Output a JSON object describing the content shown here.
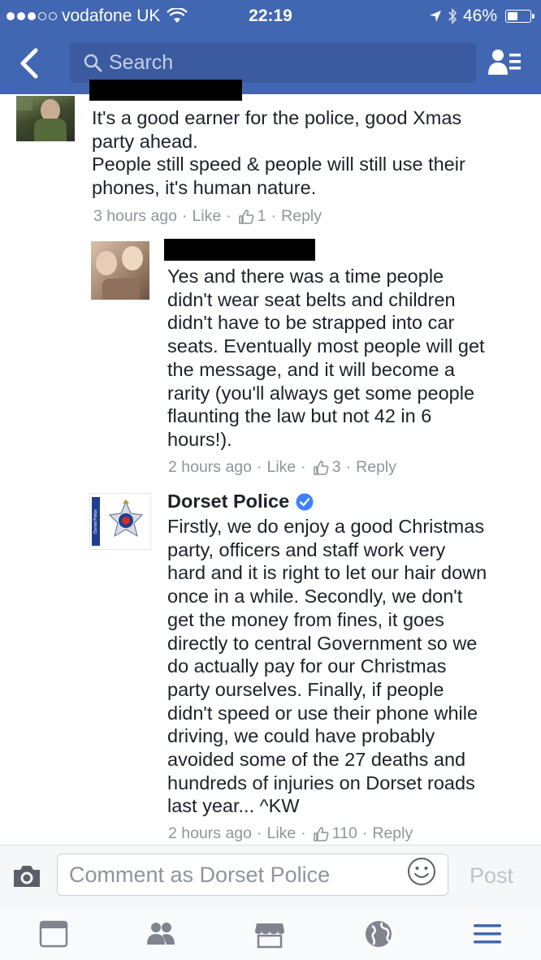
{
  "status": {
    "carrier": "vodafone UK",
    "time": "22:19",
    "battery": "46%",
    "battery_level": 0.46
  },
  "nav": {
    "search_placeholder": "Search"
  },
  "comments": [
    {
      "text": "It's a good earner for the police, good Xmas\nparty ahead.\nPeople still speed & people will still use their\nphones, it's human nature.",
      "time": "3 hours ago",
      "like_label": "Like",
      "like_count": "1",
      "reply_label": "Reply"
    },
    {
      "text": "Yes and there was a time people\ndidn't wear seat belts and children\ndidn't have to be strapped into car\nseats. Eventually most people will get\nthe message, and it will become a\nrarity (you'll always get some people\nflaunting the law but not 42 in 6\nhours!).",
      "time": "2 hours ago",
      "like_label": "Like",
      "like_count": "3",
      "reply_label": "Reply"
    },
    {
      "author": "Dorset Police",
      "text": "Firstly, we do enjoy a good Christmas\nparty, officers and staff work very\nhard and it is right to let our hair down\nonce in a while. Secondly, we don't\nget the money from fines, it goes\ndirectly to central Government so we\ndo actually pay for our Christmas\nparty ourselves. Finally, if people\ndidn't speed or use their phone while\ndriving, we could have probably\navoided some of the 27 deaths and\nhundreds of injuries on Dorset roads\nlast year... ^KW",
      "time": "2 hours ago",
      "like_label": "Like",
      "like_count": "110",
      "reply_label": "Reply",
      "logo_text": "Dorset Police"
    }
  ],
  "composer": {
    "placeholder": "Comment as Dorset Police",
    "post_label": "Post"
  },
  "colors": {
    "brand_blue": "#4267b2",
    "meta_gray": "#90949c",
    "verified_blue": "#4080ff"
  },
  "icons": [
    "back-chevron-icon",
    "search-icon",
    "friend-requests-icon",
    "thumbs-up-icon",
    "verified-badge-icon",
    "camera-icon",
    "smiley-icon",
    "news-feed-icon",
    "friends-icon",
    "marketplace-icon",
    "notifications-globe-icon",
    "menu-icon"
  ]
}
